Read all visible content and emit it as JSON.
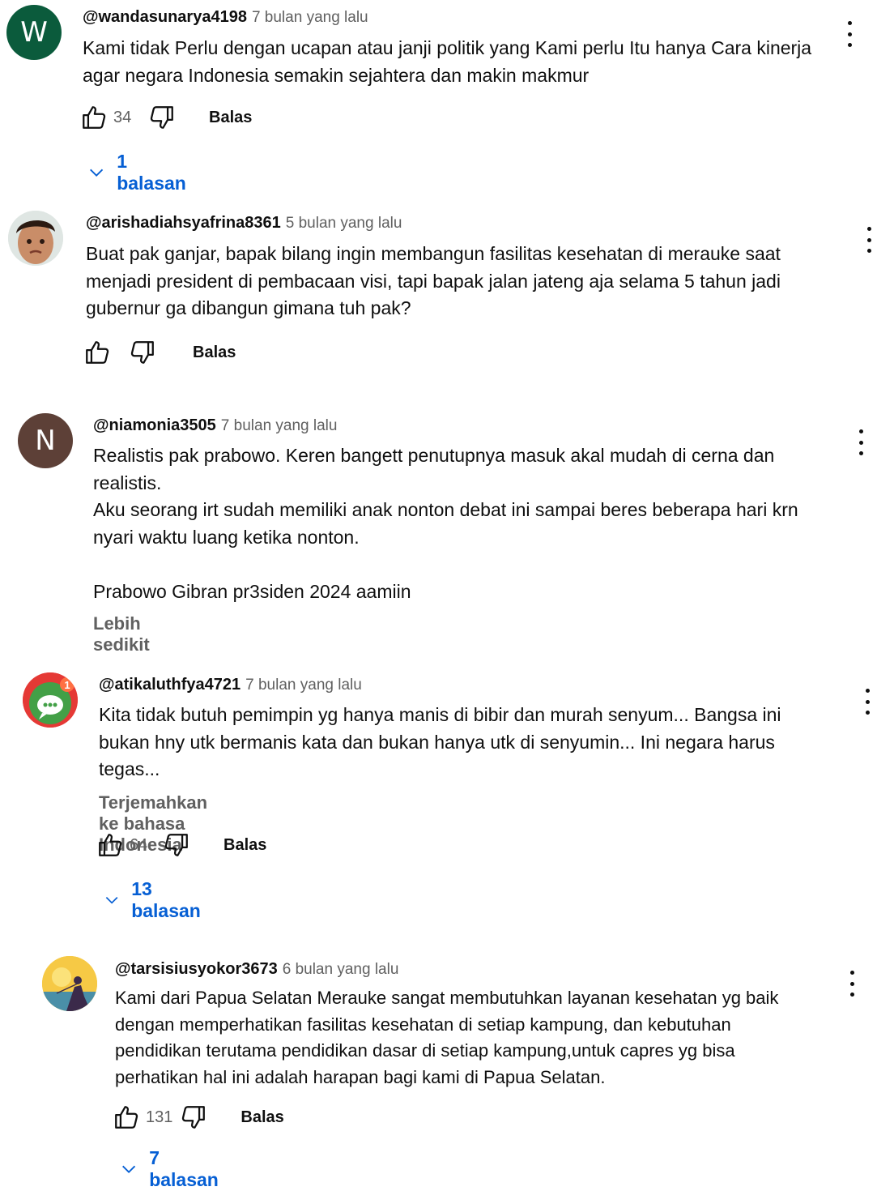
{
  "comments": [
    {
      "author": "@wandasunarya4198",
      "time": "7 bulan yang lalu",
      "avatar_letter": "W",
      "avatar_color": "#0b5b3c",
      "text": "Kami tidak Perlu dengan ucapan atau janji politik yang Kami perlu Itu hanya Cara kinerja\nagar negara Indonesia semakin sejahtera dan makin makmur",
      "likes": "34",
      "reply_label": "Balas",
      "replies_label": "1 balasan"
    },
    {
      "author": "@arishadiahsyafrina8361",
      "time": "5 bulan yang lalu",
      "avatar_icon": "child-face-photo",
      "text": "Buat pak ganjar, bapak bilang ingin membangun fasilitas kesehatan di merauke saat\nmenjadi president di pembacaan visi, tapi bapak jalan jateng aja selama 5 tahun jadi\ngubernur ga dibangun gimana tuh pak?",
      "reply_label": "Balas"
    },
    {
      "author": "@niamonia3505",
      "time": "7 bulan yang lalu",
      "avatar_letter": "N",
      "avatar_color": "#5d4037",
      "text": "Realistis pak prabowo. Keren bangett penutupnya masuk akal mudah di cerna dan\nrealistis.\nAku seorang irt sudah memiliki anak nonton debat ini sampai beres beberapa hari krn\nnyari waktu luang ketika nonton.\n\nPrabowo Gibran pr3siden 2024 aamiin",
      "collapse_label": "Lebih sedikit"
    },
    {
      "author": "@atikaluthfya4721",
      "time": "7 bulan yang lalu",
      "avatar_icon": "chat-bubble-avatar",
      "avatar_badge": "1",
      "text": "Kita tidak butuh pemimpin yg hanya manis di bibir dan murah senyum... Bangsa ini\nbukan hny utk bermanis kata dan bukan hanya utk di senyumin... Ini negara harus\ntegas...",
      "translate_label": "Terjemahkan ke bahasa Indonesia",
      "likes": "64",
      "reply_label": "Balas",
      "replies_label": "13 balasan"
    },
    {
      "author": "@tarsisiusyokor3673",
      "time": "6 bulan yang lalu",
      "avatar_icon": "fisherman-sunset-avatar",
      "text": "Kami dari Papua Selatan Merauke sangat membutuhkan layanan kesehatan yg baik\ndengan memperhatikan fasilitas kesehatan di setiap kampung, dan kebutuhan\npendidikan terutama pendidikan dasar di setiap kampung,untuk capres yg bisa\nperhatikan hal ini adalah harapan bagi kami di Papua Selatan.",
      "likes": "131",
      "reply_label": "Balas",
      "replies_label": "7 balasan"
    }
  ],
  "colors": {
    "link_blue": "#065fd4",
    "secondary_text": "#606060",
    "primary_text": "#0f0f0f"
  }
}
